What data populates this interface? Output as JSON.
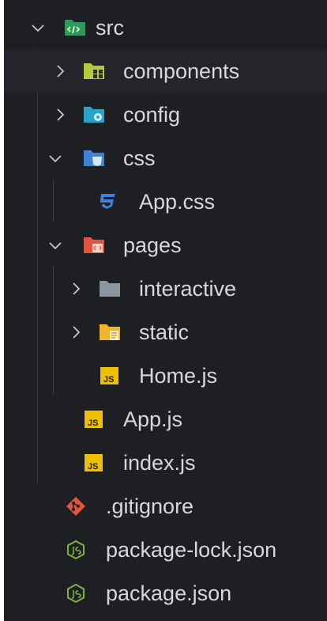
{
  "explorer": {
    "items": [
      {
        "label": "src",
        "type": "folder",
        "expanded": true,
        "icon": "folder-src-icon",
        "color": "#2e9a55"
      },
      {
        "label": "components",
        "type": "folder",
        "expanded": false,
        "icon": "folder-components-icon",
        "color": "#b6c93a"
      },
      {
        "label": "config",
        "type": "folder",
        "expanded": false,
        "icon": "folder-config-icon",
        "color": "#2aa3c9"
      },
      {
        "label": "css",
        "type": "folder",
        "expanded": true,
        "icon": "folder-css-icon",
        "color": "#3e82d8"
      },
      {
        "label": "App.css",
        "type": "file",
        "icon": "css-file-icon",
        "color": "#3e82d8"
      },
      {
        "label": "pages",
        "type": "folder",
        "expanded": true,
        "icon": "folder-pages-icon",
        "color": "#e0533c"
      },
      {
        "label": "interactive",
        "type": "folder",
        "expanded": false,
        "icon": "folder-icon",
        "color": "#8b95a0"
      },
      {
        "label": "static",
        "type": "folder",
        "expanded": false,
        "icon": "folder-static-icon",
        "color": "#f0b429"
      },
      {
        "label": "Home.js",
        "type": "file",
        "icon": "js-file-icon",
        "color": "#f0c000"
      },
      {
        "label": "App.js",
        "type": "file",
        "icon": "js-file-icon",
        "color": "#f0c000"
      },
      {
        "label": "index.js",
        "type": "file",
        "icon": "js-file-icon",
        "color": "#f0c000"
      },
      {
        "label": ".gitignore",
        "type": "file",
        "icon": "git-icon",
        "color": "#e0533c"
      },
      {
        "label": "package-lock.json",
        "type": "file",
        "icon": "nodejs-icon",
        "color": "#7cb342"
      },
      {
        "label": "package.json",
        "type": "file",
        "icon": "nodejs-icon",
        "color": "#7cb342"
      }
    ]
  }
}
